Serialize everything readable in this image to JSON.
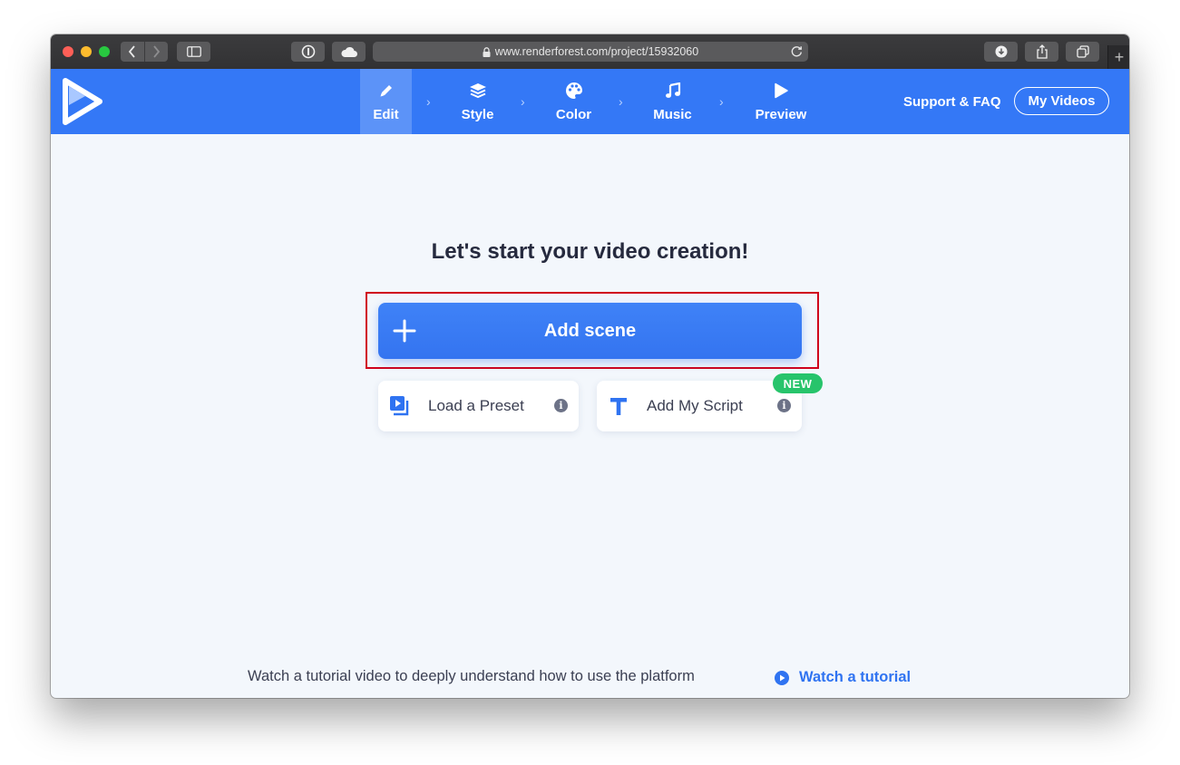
{
  "browser": {
    "url": "www.renderforest.com/project/15932060",
    "icons": [
      "back-icon",
      "forward-icon",
      "sidebar-icon",
      "onepassword-icon",
      "cloud-icon",
      "lock-icon",
      "reload-icon",
      "download-icon",
      "share-icon",
      "tabs-icon",
      "new-tab-icon"
    ],
    "new_tab_glyph": "+"
  },
  "header": {
    "accent": "#3478f6",
    "steps": [
      {
        "label": "Edit",
        "icon": "pencil-icon",
        "active": true
      },
      {
        "label": "Style",
        "icon": "layers-icon",
        "active": false
      },
      {
        "label": "Color",
        "icon": "palette-icon",
        "active": false
      },
      {
        "label": "Music",
        "icon": "music-note-icon",
        "active": false
      },
      {
        "label": "Preview",
        "icon": "play-icon",
        "active": false
      }
    ],
    "chevron": "›",
    "support_label": "Support & FAQ",
    "my_videos_label": "My Videos"
  },
  "main": {
    "headline": "Let's start your video creation!",
    "add_scene_label": "Add scene",
    "preset_label": "Load a Preset",
    "script_label": "Add My Script",
    "new_badge": "NEW",
    "info_glyph": "i",
    "tutorial_text": "Watch a tutorial video to deeply understand how to use the platform",
    "tutorial_link": "Watch a tutorial"
  }
}
